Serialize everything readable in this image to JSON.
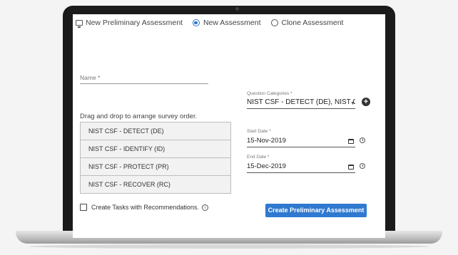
{
  "header": {
    "title": "New Preliminary Assessment",
    "radio_new": "New Assessment",
    "radio_clone": "Clone Assessment"
  },
  "form": {
    "name_label": "Name *",
    "question_categories_label": "Question Categories *",
    "question_categories_value": "NIST CSF - DETECT (DE), NIST CSF",
    "drag_label": "Drag and drop to arrange survey order.",
    "categories": [
      "NIST CSF - DETECT (DE)",
      "NIST CSF - IDENTIFY (ID)",
      "NIST CSF - PROTECT (PR)",
      "NIST CSF - RECOVER (RC)"
    ],
    "start_date_label": "Start Date *",
    "start_date_value": "15-Nov-2019",
    "end_date_label": "End Date *",
    "end_date_value": "15-Dec-2019",
    "create_tasks_label": "Create Tasks with Recommendations.",
    "create_button": "Create Preliminary Assessment"
  },
  "colors": {
    "accent": "#2f79d0",
    "bezel": "#1b1b1b"
  }
}
